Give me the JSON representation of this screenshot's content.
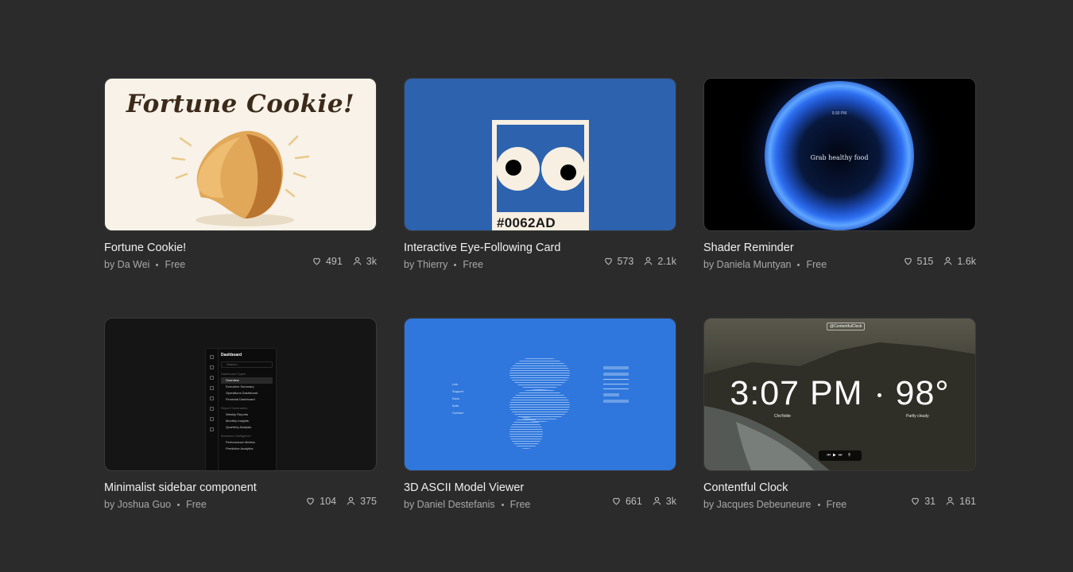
{
  "cards": [
    {
      "title": "Fortune Cookie!",
      "author": "by Da Wei",
      "price": "Free",
      "likes": "491",
      "users": "3k",
      "thumb_text": "Fortune Cookie!"
    },
    {
      "title": "Interactive Eye-Following Card",
      "author": "by Thierry",
      "price": "Free",
      "likes": "573",
      "users": "2.1k",
      "thumb_text": "#0062AD"
    },
    {
      "title": "Shader Reminder",
      "author": "by Daniela Muntyan",
      "price": "Free",
      "likes": "515",
      "users": "1.6k",
      "thumb_time": "9:30 PM",
      "thumb_text": "Grab healthy food"
    },
    {
      "title": "Minimalist sidebar component",
      "author": "by Joshua Guo",
      "price": "Free",
      "likes": "104",
      "users": "375",
      "sidebar": {
        "heading": "Dashboard",
        "search": "Search...",
        "sec1": "Dashboard Types",
        "items1": [
          "Overview",
          "Executive Summary",
          "Operations Dashboard",
          "Financial Dashboard"
        ],
        "sec2": "Report Summaries",
        "items2": [
          "Weekly Reports",
          "Monthly Insights",
          "Quarterly Analysis"
        ],
        "sec3": "Business Intelligence",
        "items3": [
          "Performance Metrics",
          "Predictive Analytics"
        ]
      }
    },
    {
      "title": "3D ASCII Model Viewer",
      "author": "by Daniel Destefanis",
      "price": "Free",
      "likes": "661",
      "users": "3k",
      "nav": [
        "Link",
        "Support",
        "Docs",
        "Ants",
        "Contact"
      ]
    },
    {
      "title": "Contentful Clock",
      "author": "by Jacques Debeuneure",
      "price": "Free",
      "likes": "31",
      "users": "161",
      "brand": "@ContentfulClock",
      "time": "3:07 PM",
      "temp": "98°",
      "left_sub": "Cho'tlotte",
      "right_sub": "Partly cloudy"
    }
  ],
  "icons": {
    "likes": "heart-icon",
    "users": "user-icon"
  }
}
